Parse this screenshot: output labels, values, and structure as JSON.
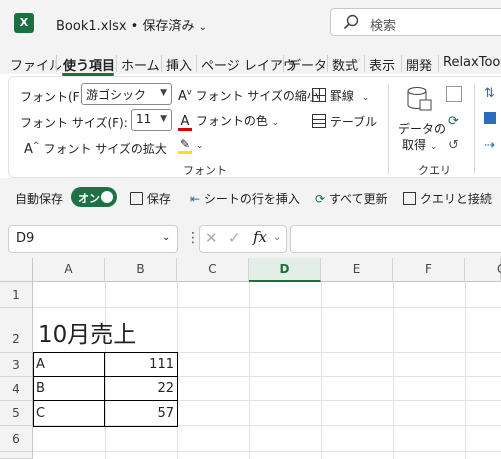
{
  "title_bar": {
    "app_icon_letter": "X",
    "file_title": "Book1.xlsx • 保存済み",
    "search_placeholder": "検索"
  },
  "tabs": [
    "ファイル",
    "使う項目",
    "ホーム",
    "挿入",
    "ページ レイアウ",
    "データ",
    "数式",
    "表示",
    "開発",
    "RelaxToo"
  ],
  "active_tab": "使う項目",
  "ribbon": {
    "font_label": "フォント(F):",
    "font_value": "游ゴシック",
    "font_size_label": "フォント サイズ(F):",
    "font_size_value": "11",
    "shrink_font": "フォント サイズの縮小",
    "grow_font": "フォント サイズの拡大",
    "font_color": "フォントの色",
    "borders": "罫線",
    "table": "テーブル",
    "font_group": "フォント",
    "get_data_line1": "データの",
    "get_data_line2": "取得",
    "query_group": "クエリ"
  },
  "quick_access": {
    "autosave": "自動保存",
    "toggle": "オン",
    "save": "保存",
    "insert_row": "シートの行を挿入",
    "refresh_all": "すべて更新",
    "query_connections": "クエリと接続"
  },
  "formula_bar": {
    "name_box": "D9",
    "fx": "fx"
  },
  "sheet": {
    "columns": [
      "A",
      "B",
      "C",
      "D",
      "E",
      "F",
      "G"
    ],
    "selected_column": "D",
    "rows": [
      "1",
      "2",
      "3",
      "4",
      "5",
      "6"
    ],
    "title": "10月売上",
    "table": [
      {
        "label": "A",
        "value": "111"
      },
      {
        "label": "B",
        "value": "22"
      },
      {
        "label": "C",
        "value": "57"
      }
    ]
  },
  "colors": {
    "excel_green": "#1e6d3c",
    "font_color_red": "#e00000",
    "highlight_yellow": "#ffe000"
  }
}
